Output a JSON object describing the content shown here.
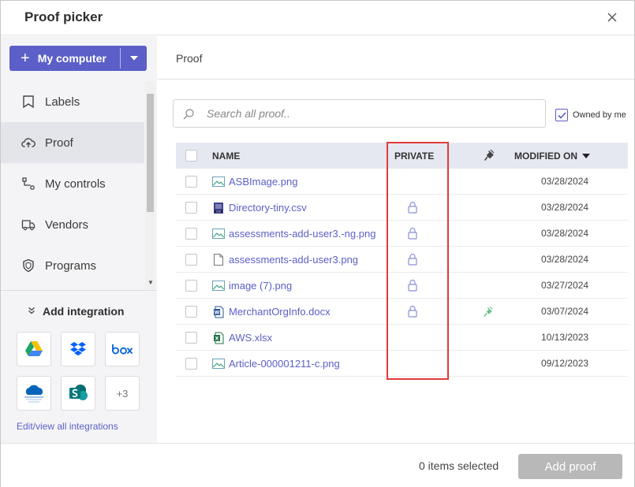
{
  "dialog": {
    "title": "Proof picker"
  },
  "sidebar": {
    "add_button_label": "My computer",
    "nav": [
      {
        "label": "Labels",
        "icon": "bookmark-icon"
      },
      {
        "label": "Proof",
        "icon": "cloud-upload-icon",
        "active": true
      },
      {
        "label": "My controls",
        "icon": "flow-icon"
      },
      {
        "label": "Vendors",
        "icon": "truck-icon"
      },
      {
        "label": "Programs",
        "icon": "shield-icon"
      }
    ],
    "integrations": {
      "heading": "Add integration",
      "tiles": [
        "Google Drive",
        "Dropbox",
        "box",
        "OneDrive for Business",
        "SharePoint",
        "+3"
      ],
      "link": "Edit/view all integrations"
    }
  },
  "main": {
    "breadcrumb": "Proof",
    "search": {
      "placeholder": "Search all proof.."
    },
    "owned_by_me": {
      "label": "Owned by me",
      "checked": true
    },
    "table": {
      "columns": {
        "name": "NAME",
        "private": "PRIVATE",
        "modified": "MODIFIED ON"
      },
      "rows": [
        {
          "name": "ASBImage.png",
          "type": "image",
          "private": false,
          "plug": false,
          "modified": "03/28/2024"
        },
        {
          "name": "Directory-tiny.csv",
          "type": "csv",
          "private": true,
          "plug": false,
          "modified": "03/28/2024"
        },
        {
          "name": "assessments-add-user3.-ng.png",
          "type": "image",
          "private": true,
          "plug": false,
          "modified": "03/28/2024"
        },
        {
          "name": "assessments-add-user3.png",
          "type": "doc",
          "private": true,
          "plug": false,
          "modified": "03/28/2024"
        },
        {
          "name": "image (7).png",
          "type": "image",
          "private": true,
          "plug": false,
          "modified": "03/27/2024"
        },
        {
          "name": "MerchantOrgInfo.docx",
          "type": "word",
          "private": true,
          "plug": true,
          "modified": "03/07/2024"
        },
        {
          "name": "AWS.xlsx",
          "type": "excel",
          "private": false,
          "plug": false,
          "modified": "10/13/2023"
        },
        {
          "name": "Article-000001211-c.png",
          "type": "image",
          "private": false,
          "plug": false,
          "modified": "09/12/2023"
        }
      ]
    }
  },
  "footer": {
    "selected_text": "0 items selected",
    "add_button": "Add proof"
  },
  "colors": {
    "accent": "#5b5fc7",
    "highlight": "#e03a3a",
    "disabled": "#b8b8b8"
  }
}
